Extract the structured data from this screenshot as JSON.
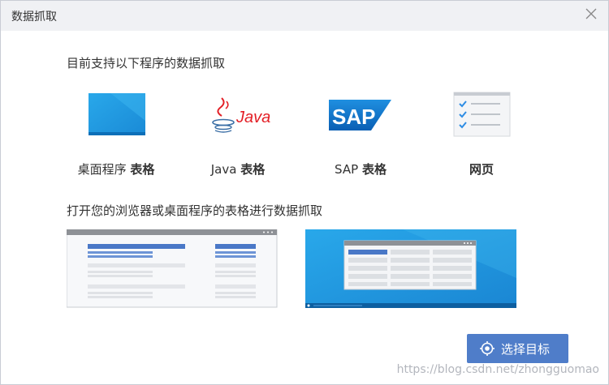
{
  "dialog": {
    "title": "数据抓取",
    "close_icon": "close-icon"
  },
  "supported": {
    "heading": "目前支持以下程序的数据抓取",
    "apps": [
      {
        "name": "桌面程序",
        "suffix": "表格",
        "icon": "desktop-window-icon"
      },
      {
        "name": "Java",
        "suffix": "表格",
        "icon": "java-logo-icon"
      },
      {
        "name": "SAP",
        "suffix": "表格",
        "icon": "sap-logo-icon"
      },
      {
        "name": "",
        "suffix": "网页",
        "icon": "web-checklist-icon"
      }
    ]
  },
  "open": {
    "heading": "打开您的浏览器或桌面程序的表格进行数据抓取"
  },
  "actions": {
    "select_target_label": "选择目标",
    "select_target_icon": "target-icon"
  },
  "watermark": "https://blog.csdn.net/zhongguomao",
  "colors": {
    "accent": "#4f7dc9",
    "desktop_blue": "#1f9be0",
    "title_bg": "#f0f1f4",
    "java_red": "#e31f26",
    "sap_blue": "#0a6ed1"
  }
}
